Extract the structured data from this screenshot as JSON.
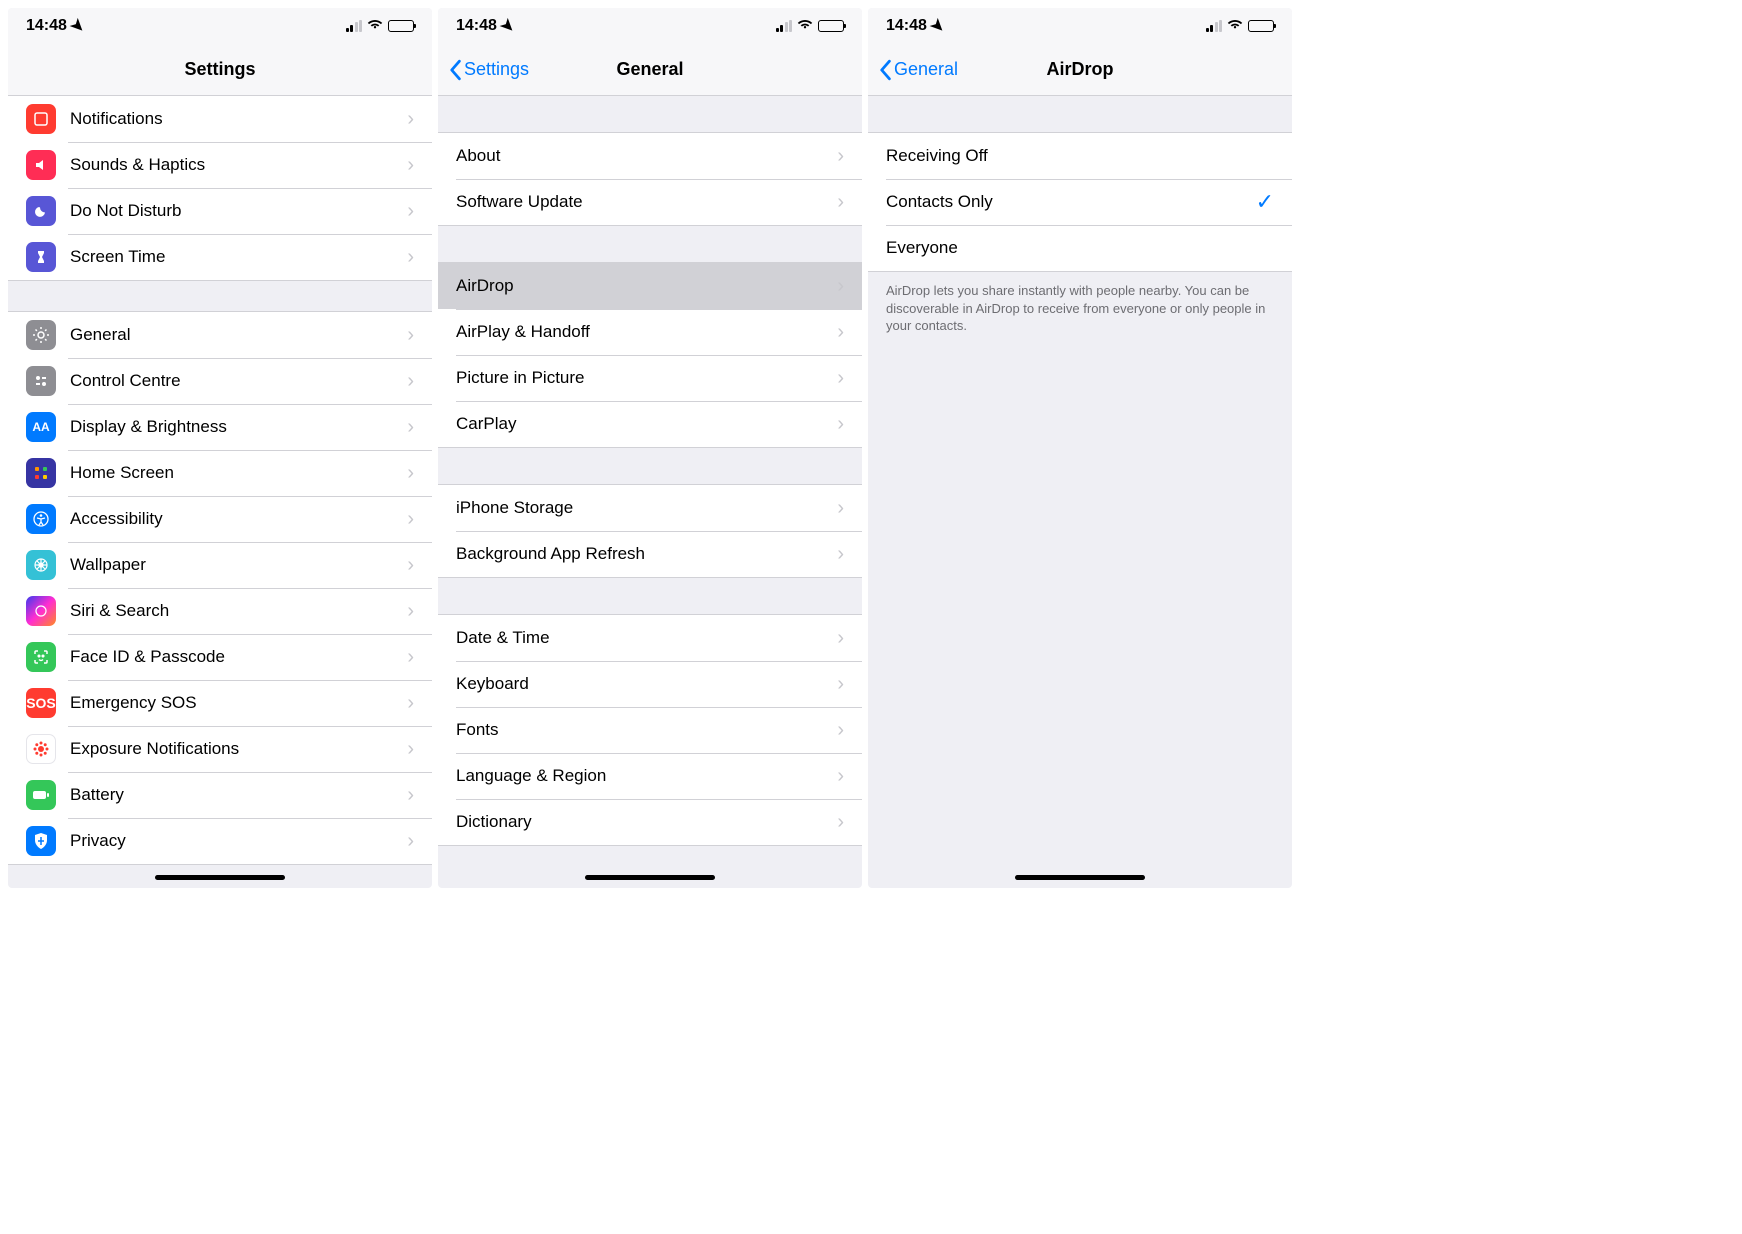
{
  "status": {
    "time": "14:48"
  },
  "screen1": {
    "title": "Settings",
    "group1": [
      {
        "label": "Notifications",
        "icon": "notifications-icon",
        "color": "ic-red"
      },
      {
        "label": "Sounds & Haptics",
        "icon": "sounds-icon",
        "color": "ic-pink"
      },
      {
        "label": "Do Not Disturb",
        "icon": "dnd-icon",
        "color": "ic-purple"
      },
      {
        "label": "Screen Time",
        "icon": "screentime-icon",
        "color": "ic-purple"
      }
    ],
    "group2": [
      {
        "label": "General",
        "icon": "general-icon",
        "color": "ic-gray"
      },
      {
        "label": "Control Centre",
        "icon": "control-centre-icon",
        "color": "ic-gray"
      },
      {
        "label": "Display & Brightness",
        "icon": "display-icon",
        "color": "ic-blue"
      },
      {
        "label": "Home Screen",
        "icon": "home-screen-icon",
        "color": "ic-home"
      },
      {
        "label": "Accessibility",
        "icon": "accessibility-icon",
        "color": "ic-access"
      },
      {
        "label": "Wallpaper",
        "icon": "wallpaper-icon",
        "color": "ic-wallpaper"
      },
      {
        "label": "Siri & Search",
        "icon": "siri-icon",
        "color": "ic-siri"
      },
      {
        "label": "Face ID & Passcode",
        "icon": "faceid-icon",
        "color": "ic-face"
      },
      {
        "label": "Emergency SOS",
        "icon": "sos-icon",
        "color": "ic-sos",
        "text": "SOS"
      },
      {
        "label": "Exposure Notifications",
        "icon": "exposure-icon",
        "color": "ic-exposure"
      },
      {
        "label": "Battery",
        "icon": "battery-icon",
        "color": "ic-green"
      },
      {
        "label": "Privacy",
        "icon": "privacy-icon",
        "color": "ic-privacy"
      }
    ]
  },
  "screen2": {
    "back": "Settings",
    "title": "General",
    "group1": [
      {
        "label": "About"
      },
      {
        "label": "Software Update"
      }
    ],
    "group2": [
      {
        "label": "AirDrop",
        "pressed": true
      },
      {
        "label": "AirPlay & Handoff"
      },
      {
        "label": "Picture in Picture"
      },
      {
        "label": "CarPlay"
      }
    ],
    "group3": [
      {
        "label": "iPhone Storage"
      },
      {
        "label": "Background App Refresh"
      }
    ],
    "group4": [
      {
        "label": "Date & Time"
      },
      {
        "label": "Keyboard"
      },
      {
        "label": "Fonts"
      },
      {
        "label": "Language & Region"
      },
      {
        "label": "Dictionary"
      }
    ]
  },
  "screen3": {
    "back": "General",
    "title": "AirDrop",
    "options": [
      {
        "label": "Receiving Off",
        "selected": false
      },
      {
        "label": "Contacts Only",
        "selected": true
      },
      {
        "label": "Everyone",
        "selected": false
      }
    ],
    "footer": "AirDrop lets you share instantly with people nearby. You can be discoverable in AirDrop to receive from everyone or only people in your contacts."
  }
}
